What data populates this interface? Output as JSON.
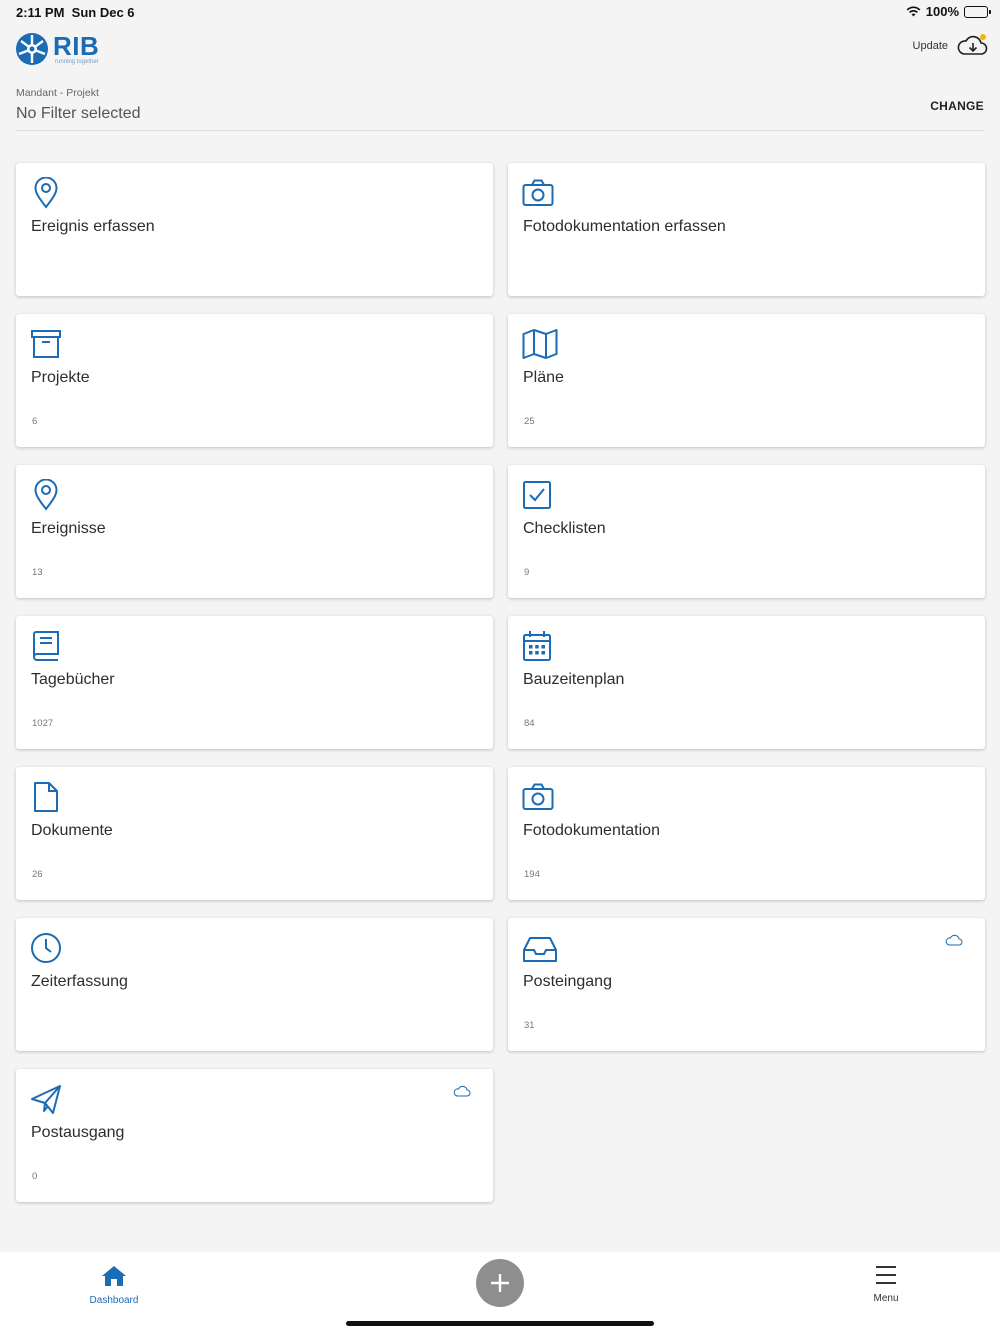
{
  "status": {
    "time": "2:11 PM",
    "date": "Sun Dec 6",
    "battery": "100%"
  },
  "header": {
    "logo_text": "RIB",
    "logo_tagline": "running together",
    "update_label": "Update",
    "filter_label": "Mandant - Projekt",
    "filter_value": "No Filter selected",
    "change_label": "CHANGE"
  },
  "cards": [
    {
      "title": "Ereignis erfassen",
      "count": "",
      "icon": "location-pin-icon"
    },
    {
      "title": "Fotodokumentation erfassen",
      "count": "",
      "icon": "camera-icon"
    },
    {
      "title": "Projekte",
      "count": "6",
      "icon": "archive-box-icon"
    },
    {
      "title": "Pläne",
      "count": "25",
      "icon": "map-icon"
    },
    {
      "title": "Ereignisse",
      "count": "13",
      "icon": "location-pin-icon"
    },
    {
      "title": "Checklisten",
      "count": "9",
      "icon": "checkbox-icon"
    },
    {
      "title": "Tagebücher",
      "count": "1027",
      "icon": "book-icon"
    },
    {
      "title": "Bauzeitenplan",
      "count": "84",
      "icon": "calendar-icon"
    },
    {
      "title": "Dokumente",
      "count": "26",
      "icon": "document-icon"
    },
    {
      "title": "Fotodokumentation",
      "count": "194",
      "icon": "camera-icon"
    },
    {
      "title": "Zeiterfassung",
      "count": "",
      "icon": "clock-icon"
    },
    {
      "title": "Posteingang",
      "count": "31",
      "icon": "inbox-icon",
      "cloud": "cloud-icon"
    },
    {
      "title": "Postausgang",
      "count": "0",
      "icon": "paper-plane-icon",
      "cloud": "cloud-icon"
    }
  ],
  "nav": {
    "dashboard_label": "Dashboard",
    "menu_label": "Menu"
  },
  "colors": {
    "accent": "#1b6bb5",
    "background": "#f4f4f4",
    "add_button": "#8e8e8e",
    "update_dot": "#f5b800"
  }
}
